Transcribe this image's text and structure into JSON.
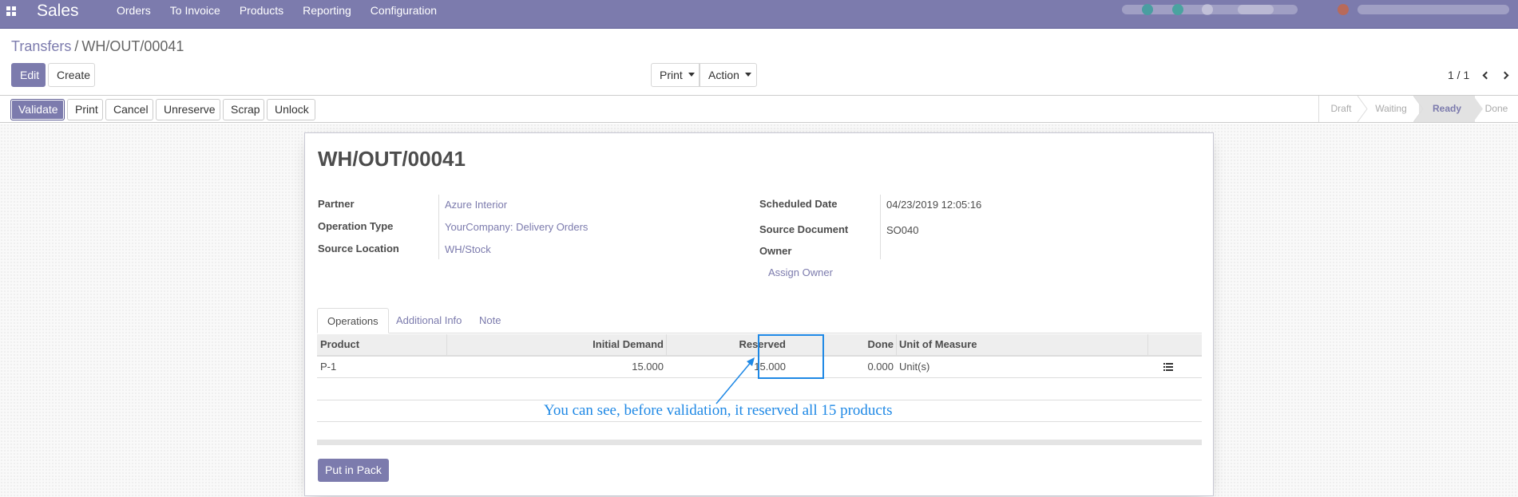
{
  "navbar": {
    "app_name": "Sales",
    "menu": [
      "Orders",
      "To Invoice",
      "Products",
      "Reporting",
      "Configuration"
    ]
  },
  "breadcrumb": {
    "parent": "Transfers",
    "separator": "/",
    "current": "WH/OUT/00041"
  },
  "control": {
    "edit": "Edit",
    "create": "Create",
    "print": "Print",
    "action": "Action",
    "pager": "1 / 1"
  },
  "statusbar": {
    "buttons": [
      "Validate",
      "Print",
      "Cancel",
      "Unreserve",
      "Scrap",
      "Unlock"
    ],
    "stages": [
      "Draft",
      "Waiting",
      "Ready",
      "Done"
    ],
    "active_stage": "Ready"
  },
  "form": {
    "title": "WH/OUT/00041",
    "left": [
      {
        "label": "Partner",
        "value": "Azure Interior"
      },
      {
        "label": "Operation Type",
        "value": "YourCompany: Delivery Orders"
      },
      {
        "label": "Source Location",
        "value": "WH/Stock"
      }
    ],
    "right": [
      {
        "label": "Scheduled Date",
        "value": "04/23/2019 12:05:16"
      },
      {
        "label": "Source Document",
        "value": "SO040"
      },
      {
        "label": "Owner",
        "value": ""
      }
    ],
    "assign_owner": "Assign Owner"
  },
  "tabs": [
    "Operations",
    "Additional Info",
    "Note"
  ],
  "table": {
    "headers": [
      "Product",
      "Initial Demand",
      "Reserved",
      "Done",
      "Unit of Measure"
    ],
    "rows": [
      {
        "product": "P-1",
        "initial_demand": "15.000",
        "reserved": "15.000",
        "done": "0.000",
        "uom": "Unit(s)"
      }
    ]
  },
  "annotation": "You can see, before validation, it reserved all 15 products",
  "put_in_pack": "Put in Pack",
  "colors": {
    "brand": "#7c7bad",
    "annotation": "#1e88e5"
  }
}
